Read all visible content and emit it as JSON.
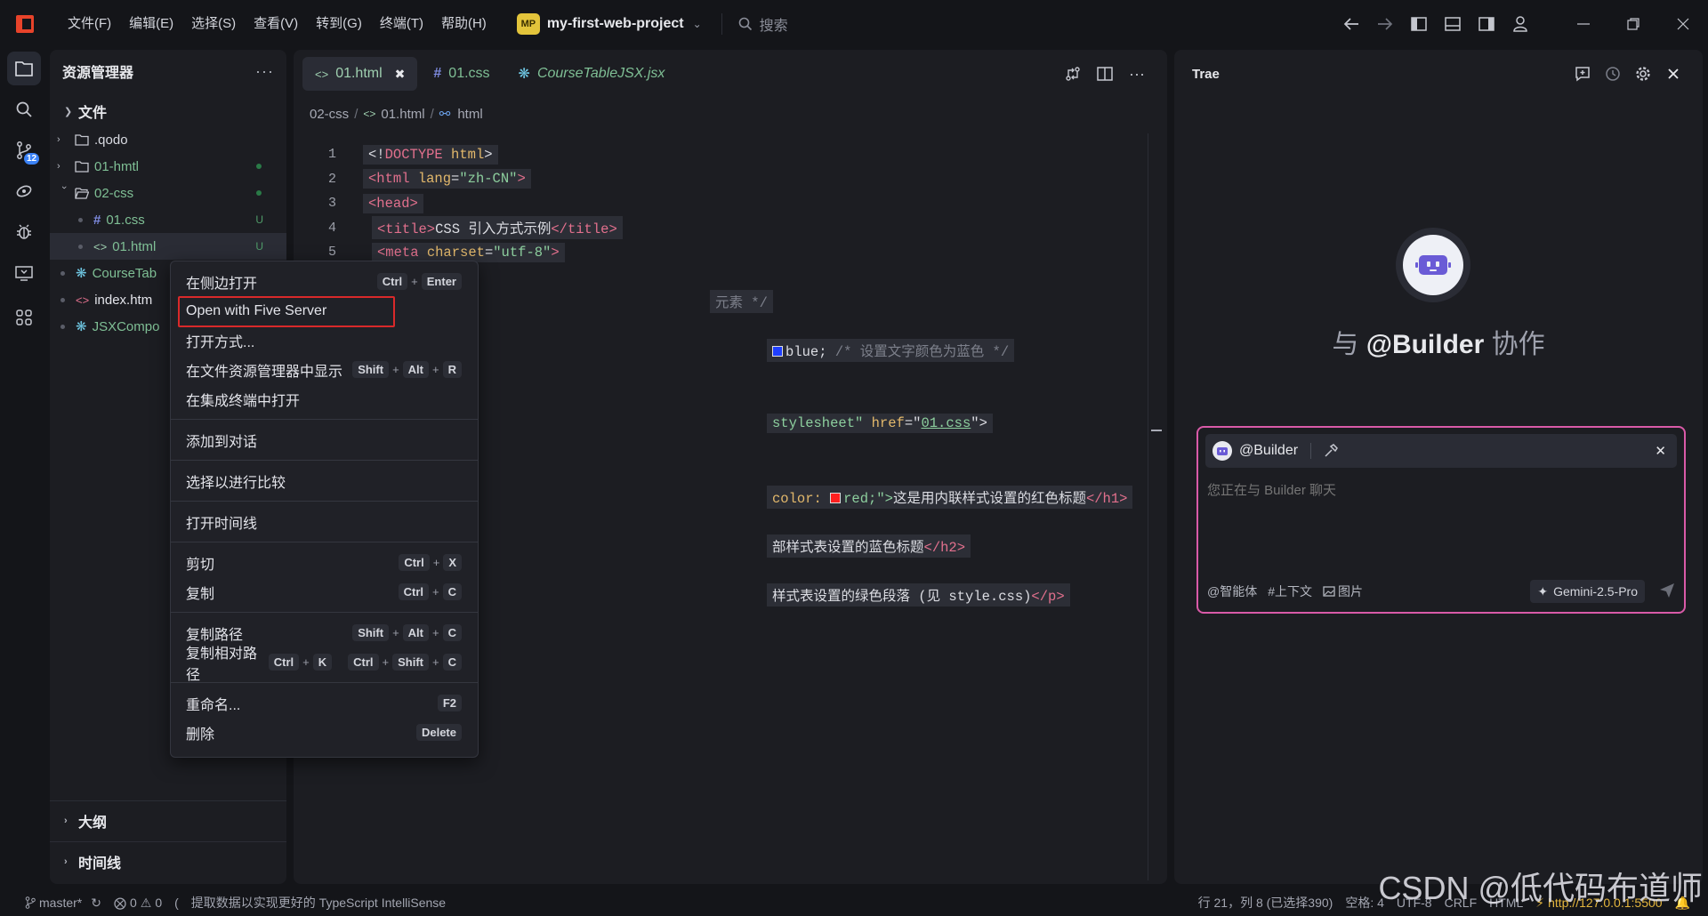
{
  "titlebar": {
    "menus": [
      "文件(F)",
      "编辑(E)",
      "选择(S)",
      "查看(V)",
      "转到(G)",
      "终端(T)",
      "帮助(H)"
    ],
    "project_badge": "MP",
    "project_name": "my-first-web-project",
    "search_placeholder": "搜索"
  },
  "activity_bar": {
    "icons": [
      "explorer-icon",
      "search-icon",
      "source-control-icon",
      "remote-icon",
      "debug-icon",
      "remote-explorer-icon",
      "extensions-icon"
    ],
    "scm_badge": "12"
  },
  "explorer": {
    "title": "资源管理器",
    "more": "···",
    "section": "文件",
    "items": [
      {
        "label": ".qodo",
        "type": "folder",
        "status": ""
      },
      {
        "label": "01-hmtl",
        "type": "folder",
        "status": "dot"
      },
      {
        "label": "02-css",
        "type": "folder-open",
        "status": "dot"
      },
      {
        "label": "01.css",
        "type": "css",
        "status": "U"
      },
      {
        "label": "01.html",
        "type": "html",
        "status": "U"
      },
      {
        "label": "CourseTab",
        "type": "react",
        "status": ""
      },
      {
        "label": "index.htm",
        "type": "html",
        "status": ""
      },
      {
        "label": "JSXCompo",
        "type": "react",
        "status": ""
      }
    ],
    "outline_label": "大纲",
    "timeline_label": "时间线"
  },
  "editor": {
    "tabs": [
      {
        "label": "01.html",
        "icon": "<>"
      },
      {
        "label": "01.css",
        "icon": "#"
      },
      {
        "label": "CourseTableJSX.jsx",
        "icon": "react"
      }
    ],
    "breadcrumb": [
      "02-css",
      "01.html",
      "html"
    ],
    "line_numbers": [
      "1",
      "2",
      "3",
      "4",
      "5"
    ],
    "code": {
      "l1_a": "<!",
      "l1_b": "DOCTYPE",
      "l1_c": " html",
      "l1_d": ">",
      "l2_a": "<html",
      "l2_b": " lang",
      "l2_c": "=",
      "l2_d": "\"zh-CN\"",
      "l2_e": ">",
      "l3_a": "<head>",
      "l4_a": "<title>",
      "l4_b": "CSS 引入方式示例",
      "l4_c": "</title>",
      "l5_a": "<meta",
      "l5_b": " charset",
      "l5_c": "=",
      "l5_d": "\"utf-8\"",
      "l5_e": ">",
      "l7": "元素 */",
      "l9_a": "blue;",
      "l9_b": " /* 设置文字颜色为蓝色 */",
      "l12_a": "stylesheet\"",
      "l12_b": " href",
      "l12_c": "=\"",
      "l12_d": "01.css",
      "l12_e": "\">",
      "l15_a": "color: ",
      "l15_b": "red;\">",
      "l15_c": "这是用内联样式设置的红色标题",
      "l15_d": "</h1>",
      "l17_a": "部样式表设置的蓝色标题",
      "l17_b": "</h2>",
      "l19_a": "样式表设置的绿色段落 (见 style.css)",
      "l19_b": "</p>"
    }
  },
  "context_menu": {
    "items": [
      {
        "label": "在侧边打开",
        "keys": [
          [
            "Ctrl",
            "Enter"
          ]
        ]
      },
      {
        "label": "Open with Five Server",
        "keys": []
      },
      {
        "label": "打开方式...",
        "keys": []
      },
      {
        "label": "在文件资源管理器中显示",
        "keys": [
          [
            "Shift",
            "Alt",
            "R"
          ]
        ]
      },
      {
        "label": "在集成终端中打开",
        "keys": []
      },
      {
        "label": "添加到对话",
        "keys": []
      },
      {
        "label": "选择以进行比较",
        "keys": []
      },
      {
        "label": "打开时间线",
        "keys": []
      },
      {
        "label": "剪切",
        "keys": [
          [
            "Ctrl",
            "X"
          ]
        ]
      },
      {
        "label": "复制",
        "keys": [
          [
            "Ctrl",
            "C"
          ]
        ]
      },
      {
        "label": "复制路径",
        "keys": [
          [
            "Shift",
            "Alt",
            "C"
          ]
        ]
      },
      {
        "label": "复制相对路径",
        "keys": [
          [
            "Ctrl",
            "K"
          ],
          [
            "Ctrl",
            "Shift",
            "C"
          ]
        ]
      },
      {
        "label": "重命名...",
        "keys": [
          [
            "F2"
          ]
        ]
      },
      {
        "label": "删除",
        "keys": [
          [
            "Delete"
          ]
        ]
      }
    ]
  },
  "trae": {
    "title": "Trae",
    "collab_prefix": "与 ",
    "collab_name": "@Builder",
    "collab_suffix": " 协作",
    "agent_name": "@Builder",
    "input_placeholder": "您正在与 Builder 聊天",
    "chips": [
      "@智能体",
      "#上下文",
      "图片"
    ],
    "model": "Gemini-2.5-Pro"
  },
  "statusbar": {
    "branch": "master*",
    "errors": "0",
    "warnings": "0",
    "message": "提取数据以实现更好的 TypeScript IntelliSense",
    "position": "行 21，列 8 (已选择390)",
    "indent": "空格: 4",
    "encoding": "UTF-8",
    "eol": "CRLF",
    "language": "HTML",
    "server": "http://127.0.0.1:5500"
  },
  "watermark": "CSDN @低代码布道师",
  "colors": {
    "accent": "#3b82f6",
    "highlight_box": "#d9292a",
    "chat_border": "#d95aa8",
    "server": "#e3b53d"
  }
}
